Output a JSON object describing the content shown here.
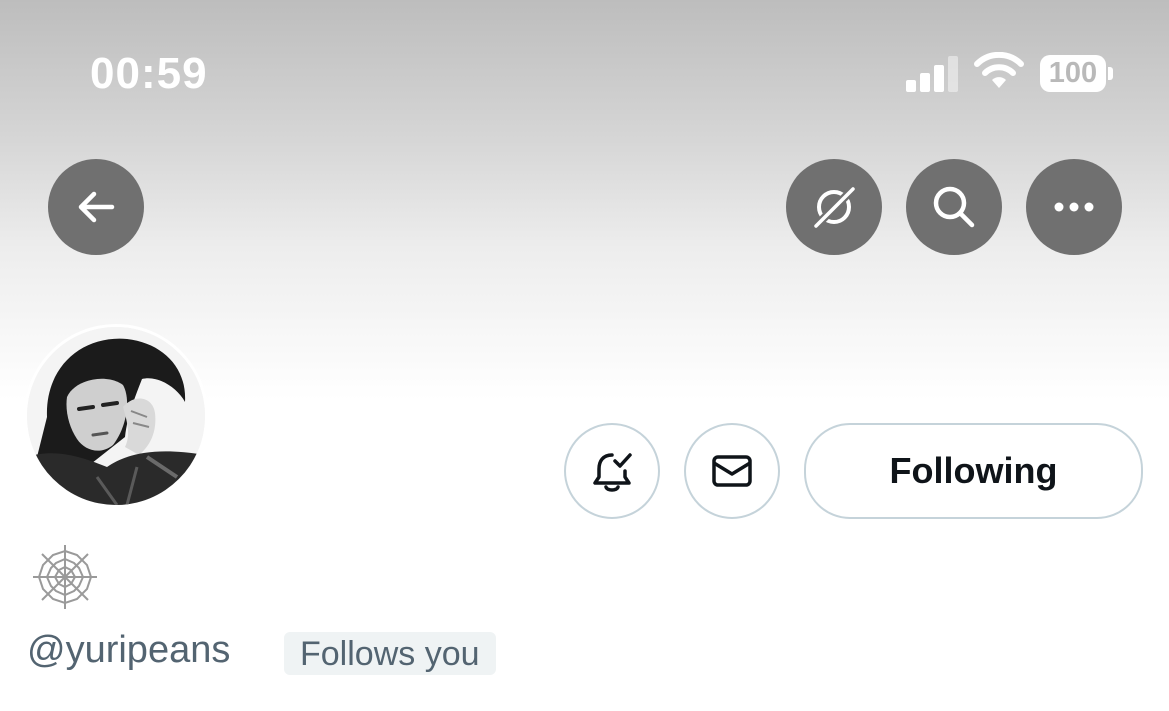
{
  "status_bar": {
    "time": "00:59",
    "battery": "100",
    "signal_icon": "cellular-signal-icon",
    "wifi_icon": "wifi-icon",
    "signal_bars_lit": 3,
    "signal_bars_total": 4
  },
  "header": {
    "back_icon": "arrow-left-icon",
    "grok_icon": "slashed-circle-icon",
    "search_icon": "search-icon",
    "more_icon": "more-horizontal-icon",
    "button_color": "#707070"
  },
  "profile": {
    "display_name_emoji": "spider-web-emoji",
    "handle": "@yuripeans",
    "follows_you": "Follows you"
  },
  "actions": {
    "notifications_icon": "bell-check-icon",
    "message_icon": "envelope-icon",
    "following_label": "Following",
    "border_color": "#c5d3da"
  }
}
